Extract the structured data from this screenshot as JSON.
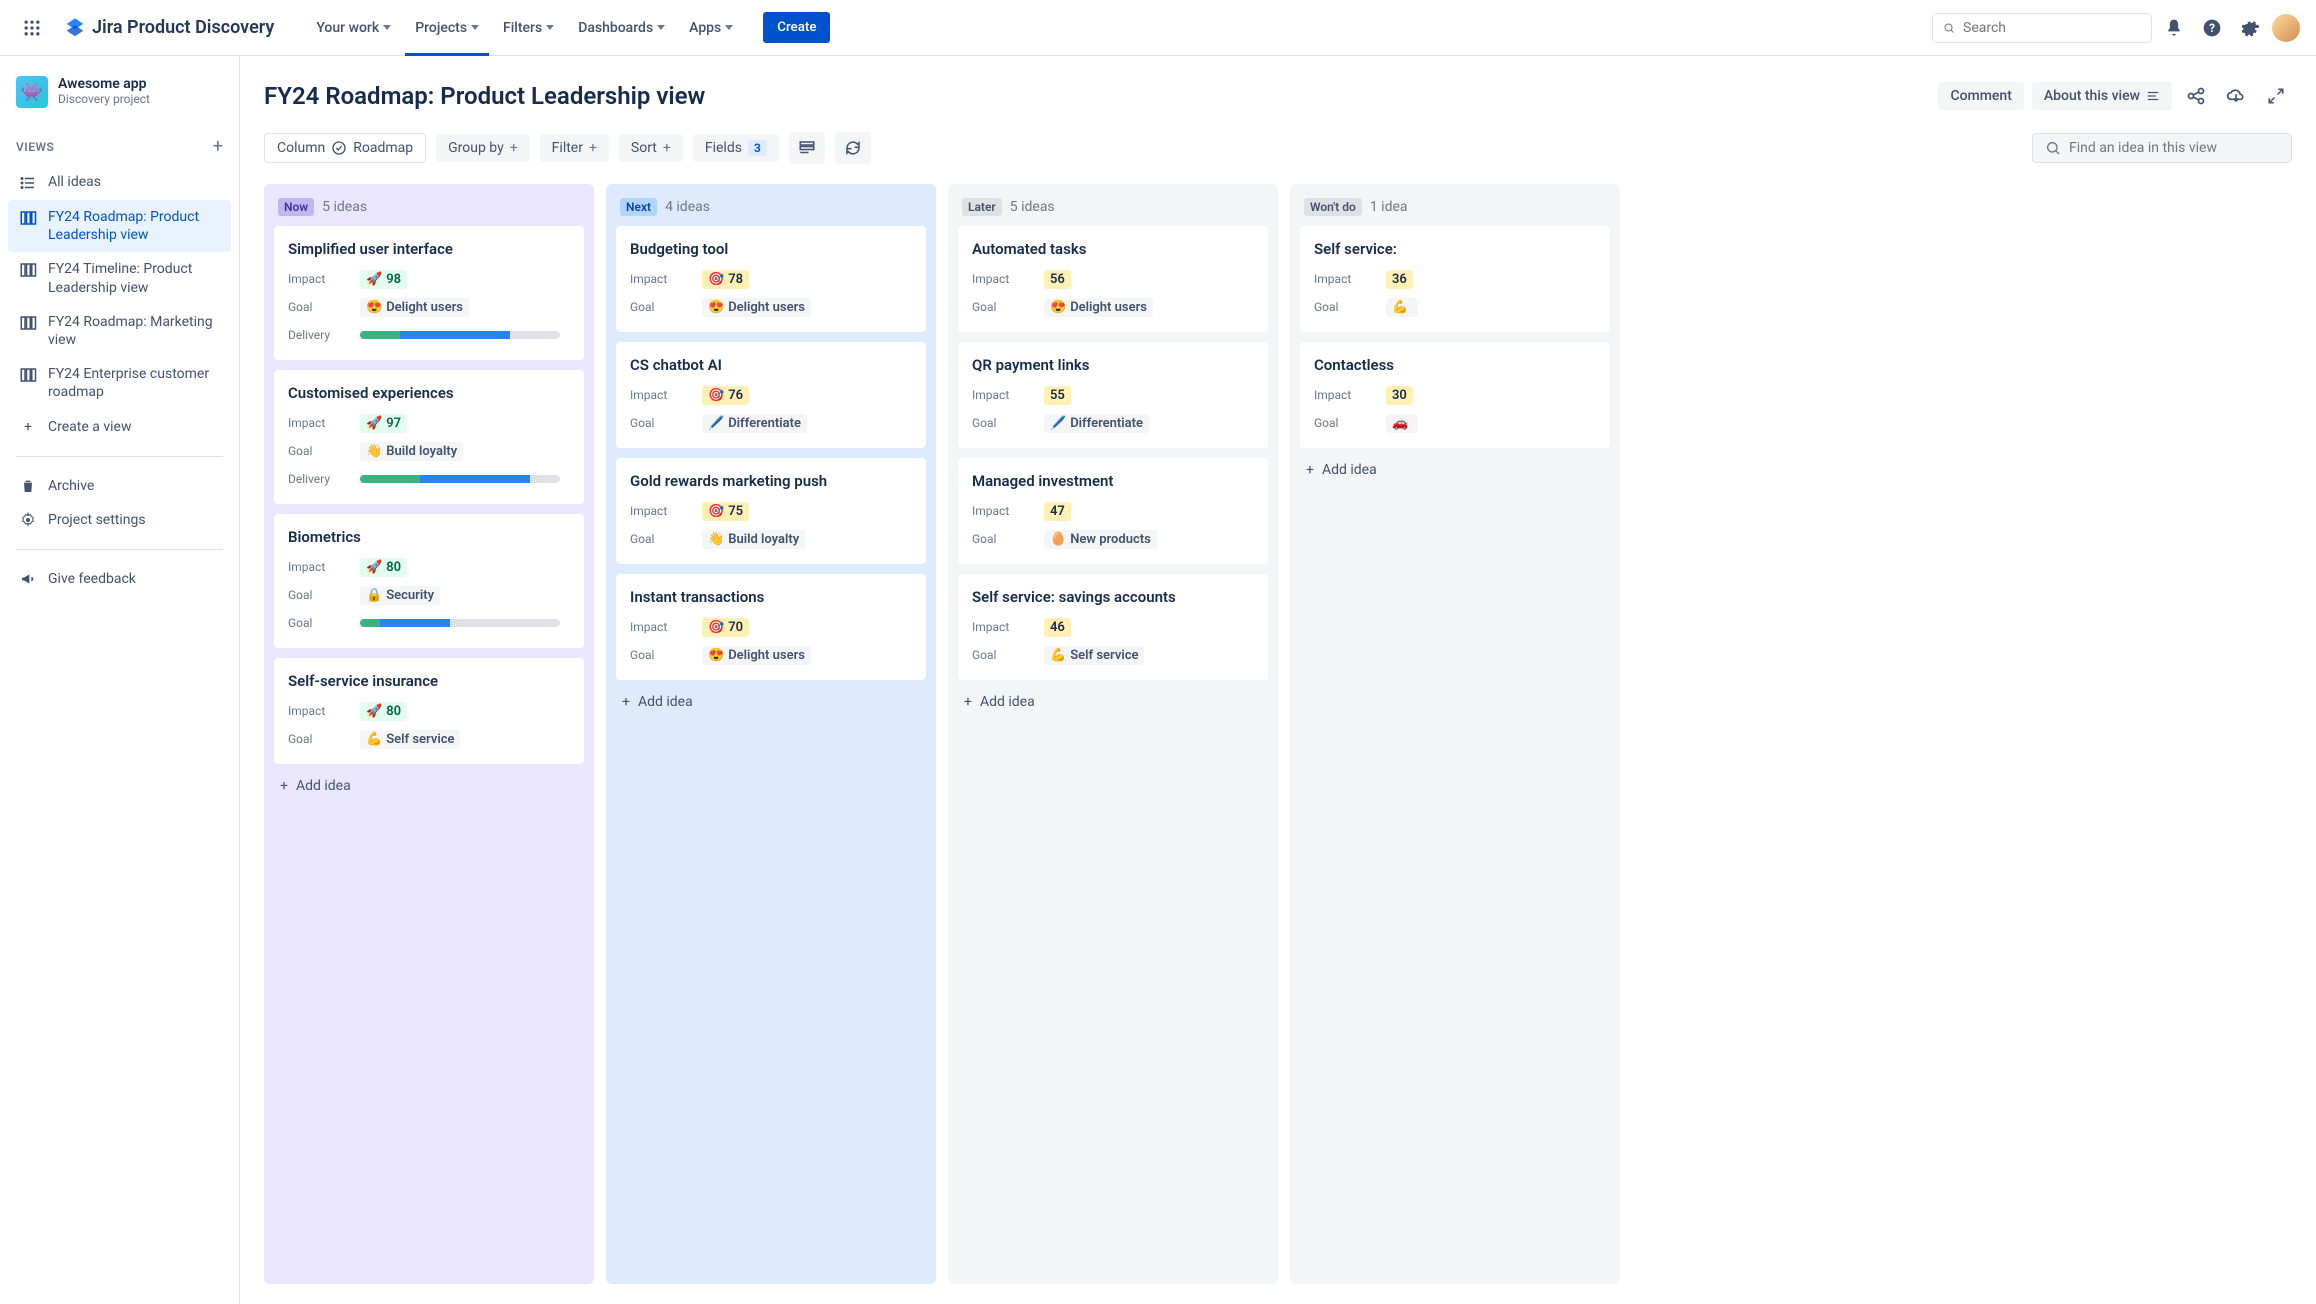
{
  "nav": {
    "productName": "Jira Product Discovery",
    "items": [
      "Your work",
      "Projects",
      "Filters",
      "Dashboards",
      "Apps"
    ],
    "activeIndex": 1,
    "createLabel": "Create",
    "searchPlaceholder": "Search"
  },
  "sidebar": {
    "project": {
      "name": "Awesome app",
      "subtitle": "Discovery project"
    },
    "viewsLabel": "VIEWS",
    "views": [
      {
        "label": "All ideas",
        "icon": "list"
      },
      {
        "label": "FY24 Roadmap: Product Leadership view",
        "icon": "board",
        "active": true
      },
      {
        "label": "FY24 Timeline: Product Leadership view",
        "icon": "board"
      },
      {
        "label": "FY24 Roadmap: Marketing view",
        "icon": "board"
      },
      {
        "label": "FY24 Enterprise customer roadmap",
        "icon": "board"
      }
    ],
    "createViewLabel": "Create a view",
    "archiveLabel": "Archive",
    "projectSettingsLabel": "Project settings",
    "giveFeedbackLabel": "Give feedback"
  },
  "page": {
    "title": "FY24 Roadmap: Product Leadership view",
    "commentLabel": "Comment",
    "aboutLabel": "About this view"
  },
  "toolbar": {
    "column": {
      "label": "Column",
      "value": "Roadmap"
    },
    "groupBy": "Group by",
    "filter": "Filter",
    "sort": "Sort",
    "fields": {
      "label": "Fields",
      "count": "3"
    },
    "findPlaceholder": "Find an idea in this view"
  },
  "columns": [
    {
      "key": "now",
      "badge": "Now",
      "count": "5 ideas",
      "addLabel": "Add idea",
      "cards": [
        {
          "title": "Simplified user interface",
          "impact": {
            "emoji": "🚀",
            "value": "98",
            "color": "green"
          },
          "goal": {
            "emoji": "😍",
            "text": "Delight users"
          },
          "delivery": {
            "green": 20,
            "blue": 55
          }
        },
        {
          "title": "Customised experiences",
          "impact": {
            "emoji": "🚀",
            "value": "97",
            "color": "green"
          },
          "goal": {
            "emoji": "👋",
            "text": "Build loyalty"
          },
          "delivery": {
            "green": 30,
            "blue": 55
          }
        },
        {
          "title": "Biometrics",
          "impact": {
            "emoji": "🚀",
            "value": "80",
            "color": "green"
          },
          "goal": {
            "emoji": "🔒",
            "text": "Security"
          },
          "delivery": {
            "green": 10,
            "blue": 35,
            "label": "Goal"
          }
        },
        {
          "title": "Self-service insurance",
          "impact": {
            "emoji": "🚀",
            "value": "80",
            "color": "green"
          },
          "goal": {
            "emoji": "💪",
            "text": "Self service"
          }
        }
      ]
    },
    {
      "key": "next",
      "badge": "Next",
      "count": "4 ideas",
      "addLabel": "Add idea",
      "cards": [
        {
          "title": "Budgeting tool",
          "impact": {
            "emoji": "🎯",
            "value": "78",
            "color": "yellow"
          },
          "goal": {
            "emoji": "😍",
            "text": "Delight users"
          }
        },
        {
          "title": "CS chatbot AI",
          "impact": {
            "emoji": "🎯",
            "value": "76",
            "color": "yellow"
          },
          "goal": {
            "emoji": "🖊️",
            "text": "Differentiate"
          }
        },
        {
          "title": "Gold rewards marketing push",
          "impact": {
            "emoji": "🎯",
            "value": "75",
            "color": "yellow"
          },
          "goal": {
            "emoji": "👋",
            "text": "Build loyalty"
          }
        },
        {
          "title": "Instant transactions",
          "impact": {
            "emoji": "🎯",
            "value": "70",
            "color": "yellow"
          },
          "goal": {
            "emoji": "😍",
            "text": "Delight users"
          }
        }
      ]
    },
    {
      "key": "later",
      "badge": "Later",
      "count": "5 ideas",
      "addLabel": "Add idea",
      "cards": [
        {
          "title": "Automated tasks",
          "impact": {
            "value": "56",
            "color": "yellow"
          },
          "goal": {
            "emoji": "😍",
            "text": "Delight users"
          }
        },
        {
          "title": "QR payment links",
          "impact": {
            "value": "55",
            "color": "yellow"
          },
          "goal": {
            "emoji": "🖊️",
            "text": "Differentiate"
          }
        },
        {
          "title": "Managed investment",
          "impact": {
            "value": "47",
            "color": "yellow"
          },
          "goal": {
            "emoji": "🥚",
            "text": "New products"
          }
        },
        {
          "title": "Self service: savings accounts",
          "impact": {
            "value": "46",
            "color": "yellow"
          },
          "goal": {
            "emoji": "💪",
            "text": "Self service"
          }
        }
      ]
    },
    {
      "key": "wont",
      "badge": "Won't do",
      "count": "1 idea",
      "addLabel": "Add idea",
      "cards": [
        {
          "title": "Self service:",
          "impact": {
            "value": "36",
            "color": "yellow"
          },
          "goal": {
            "emoji": "💪",
            "text": ""
          }
        },
        {
          "title": "Contactless",
          "impact": {
            "value": "30",
            "color": "yellow"
          },
          "goal": {
            "emoji": "🚗",
            "text": ""
          }
        }
      ]
    }
  ]
}
